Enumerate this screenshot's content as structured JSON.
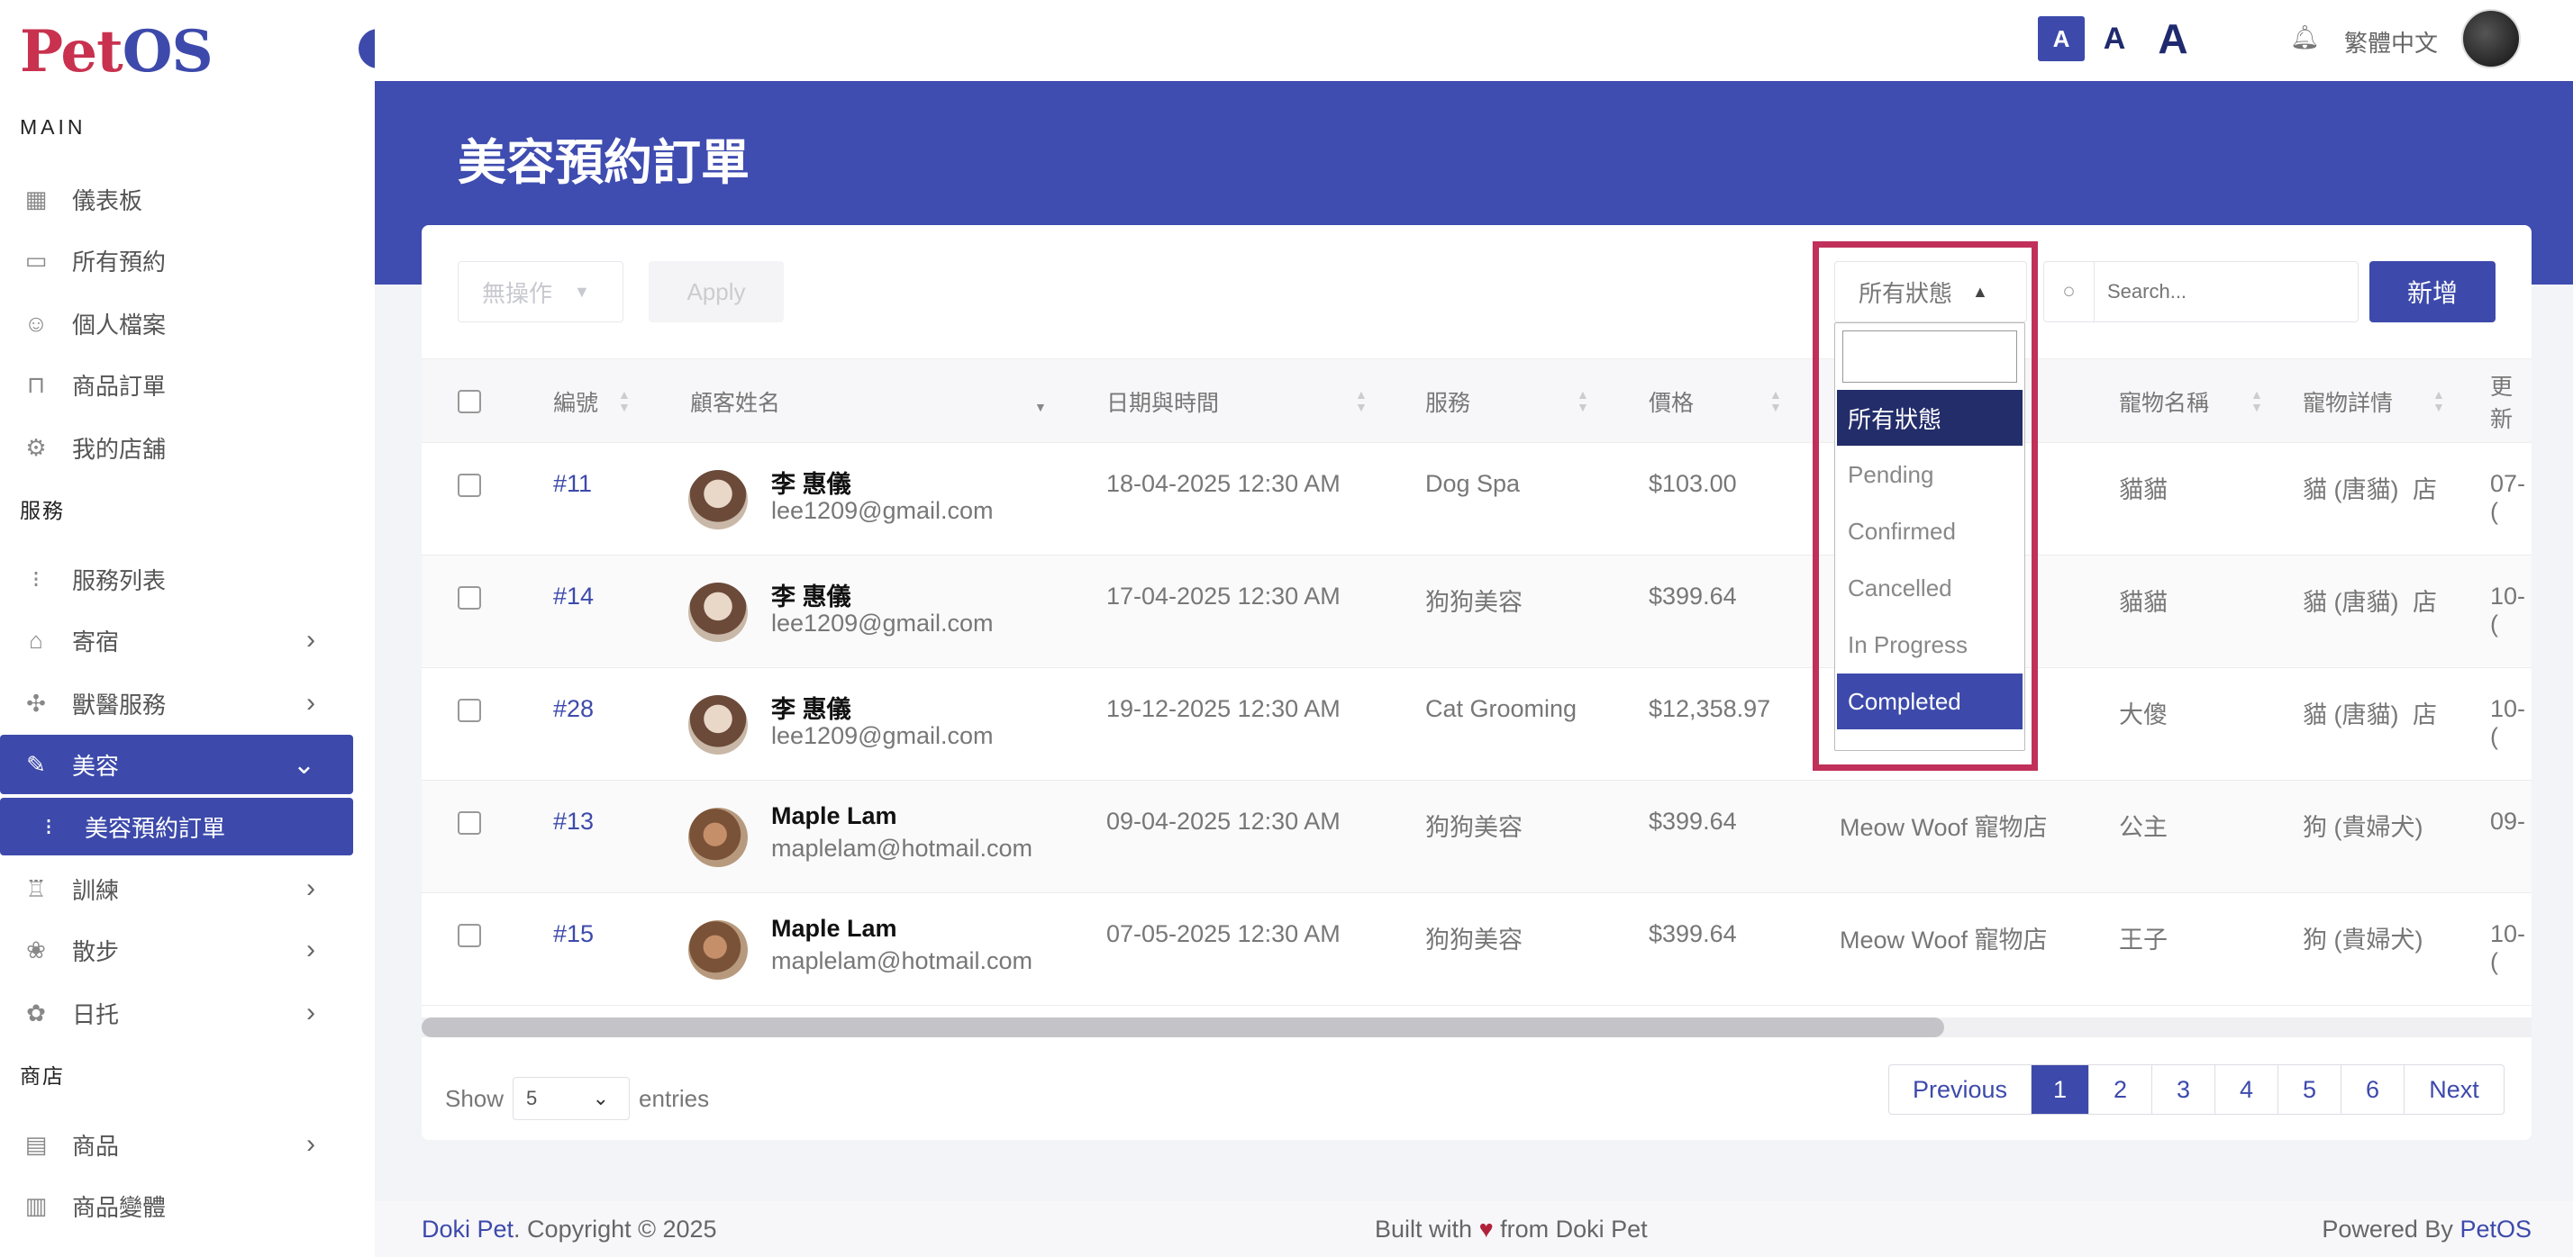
{
  "brand": {
    "logo_p": "Pet",
    "logo_os": "OS"
  },
  "sidebar": {
    "sections": {
      "main": "MAIN",
      "services": "服務",
      "shop": "商店"
    },
    "items": [
      {
        "label": "儀表板",
        "icon": "grid-icon"
      },
      {
        "label": "所有預約",
        "icon": "calendar-icon"
      },
      {
        "label": "個人檔案",
        "icon": "user-icon"
      },
      {
        "label": "商品訂單",
        "icon": "bag-icon"
      },
      {
        "label": "我的店舖",
        "icon": "store-icon"
      },
      {
        "label": "服務列表",
        "icon": "list-icon"
      },
      {
        "label": "寄宿",
        "icon": "home-icon"
      },
      {
        "label": "獸醫服務",
        "icon": "medical-icon"
      },
      {
        "label": "美容",
        "icon": "brush-icon"
      },
      {
        "label": "美容預約訂單",
        "icon": "sub-list-icon"
      },
      {
        "label": "訓練",
        "icon": "training-icon"
      },
      {
        "label": "散步",
        "icon": "walk-icon"
      },
      {
        "label": "日托",
        "icon": "daycare-icon"
      },
      {
        "label": "商品",
        "icon": "product-icon"
      },
      {
        "label": "商品變體",
        "icon": "variant-icon"
      }
    ]
  },
  "topbar": {
    "font_small": "A",
    "font_medium": "A",
    "font_large": "A",
    "language": "繁體中文"
  },
  "page": {
    "title": "美容預約訂單"
  },
  "toolbar": {
    "bulk_action": "無操作",
    "apply_label": "Apply",
    "status_filter": "所有狀態",
    "search_placeholder": "Search...",
    "add_label": "新增"
  },
  "status_dropdown": {
    "options": [
      "所有狀態",
      "Pending",
      "Confirmed",
      "Cancelled",
      "In Progress",
      "Completed"
    ]
  },
  "table": {
    "headers": {
      "id": "編號",
      "customer": "顧客姓名",
      "datetime": "日期與時間",
      "service": "服務",
      "price": "價格",
      "pet_name": "寵物名稱",
      "pet_detail": "寵物詳情",
      "updated": "更新"
    },
    "rows": [
      {
        "id": "#11",
        "name": "李 惠儀",
        "email": "lee1209@gmail.com",
        "datetime": "18-04-2025 12:30 AM",
        "service": "Dog Spa",
        "price": "$103.00",
        "shop": "店",
        "pet_name": "貓貓",
        "pet_detail": "貓 (唐貓)",
        "updated": "07-("
      },
      {
        "id": "#14",
        "name": "李 惠儀",
        "email": "lee1209@gmail.com",
        "datetime": "17-04-2025 12:30 AM",
        "service": "狗狗美容",
        "price": "$399.64",
        "shop": "店",
        "pet_name": "貓貓",
        "pet_detail": "貓 (唐貓)",
        "updated": "10-("
      },
      {
        "id": "#28",
        "name": "李 惠儀",
        "email": "lee1209@gmail.com",
        "datetime": "19-12-2025 12:30 AM",
        "service": "Cat Grooming",
        "price": "$12,358.97",
        "shop": "店",
        "pet_name": "大傻",
        "pet_detail": "貓 (唐貓)",
        "updated": "10-("
      },
      {
        "id": "#13",
        "name": "Maple Lam",
        "email": "maplelam@hotmail.com",
        "datetime": "09-04-2025 12:30 AM",
        "service": "狗狗美容",
        "price": "$399.64",
        "shop": "Meow Woof 寵物店",
        "pet_name": "公主",
        "pet_detail": "狗 (貴婦犬)",
        "updated": "09-"
      },
      {
        "id": "#15",
        "name": "Maple Lam",
        "email": "maplelam@hotmail.com",
        "datetime": "07-05-2025 12:30 AM",
        "service": "狗狗美容",
        "price": "$399.64",
        "shop": "Meow Woof 寵物店",
        "pet_name": "王子",
        "pet_detail": "狗 (貴婦犬)",
        "updated": "10-("
      }
    ]
  },
  "pagination": {
    "show_label": "Show",
    "entries_value": "5",
    "entries_label": "entries",
    "previous": "Previous",
    "next": "Next",
    "pages": [
      "1",
      "2",
      "3",
      "4",
      "5",
      "6"
    ],
    "current": "1"
  },
  "footer": {
    "brand": "Doki Pet",
    "copyright": ". Copyright © 2025",
    "built_prefix": "Built with",
    "heart": "♥",
    "built_suffix": "from Doki Pet",
    "powered_prefix": "Powered By",
    "powered_brand": "PetOS"
  },
  "colors": {
    "primary": "#3d4aab",
    "highlight": "#c0305a",
    "logo_red": "#c8324f"
  }
}
